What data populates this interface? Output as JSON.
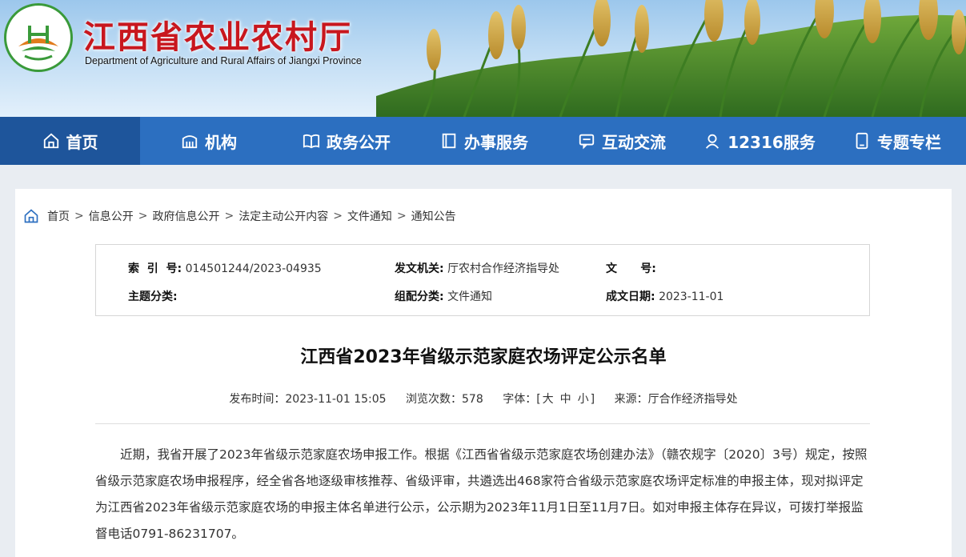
{
  "header": {
    "title": "江西省农业农村厅",
    "subtitle": "Department of Agriculture and Rural Affairs of Jiangxi Province"
  },
  "nav": [
    {
      "label": "首页",
      "icon": "home-icon",
      "active": true
    },
    {
      "label": "机构",
      "icon": "building-icon"
    },
    {
      "label": "政务公开",
      "icon": "book-icon"
    },
    {
      "label": "办事服务",
      "icon": "document-icon"
    },
    {
      "label": "互动交流",
      "icon": "chat-icon"
    },
    {
      "label": "12316服务",
      "icon": "service-icon"
    },
    {
      "label": "专题专栏",
      "icon": "tablet-icon"
    }
  ],
  "breadcrumb": [
    "首页",
    "信息公开",
    "政府信息公开",
    "法定主动公开内容",
    "文件通知",
    "通知公告"
  ],
  "info": {
    "index_label": "索  引  号:",
    "index_value": "014501244/2023-04935",
    "issuer_label": "发文机关:",
    "issuer_value": "厅农村合作经济指导处",
    "docno_label": "文      号:",
    "docno_value": "",
    "topic_label": "主题分类:",
    "topic_value": "",
    "genre_label": "组配分类:",
    "genre_value": "文件通知",
    "date_label": "成文日期:",
    "date_value": "2023-11-01"
  },
  "doc": {
    "title": "江西省2023年省级示范家庭农场评定公示名单",
    "publish_time": "发布时间：2023-11-01 15:05",
    "views": "浏览次数：578",
    "font_label": "字体：[",
    "font_big": "大",
    "font_mid": "中",
    "font_small": "小",
    "font_close": "]",
    "source": "来源：厅合作经济指导处",
    "body": "近期，我省开展了2023年省级示范家庭农场申报工作。根据《江西省省级示范家庭农场创建办法》（赣农规字〔2020〕3号）规定，按照省级示范家庭农场申报程序，经全省各地逐级审核推荐、省级评审，共遴选出468家符合省级示范家庭农场评定标准的申报主体，现对拟评定为江西省2023年省级示范家庭农场的申报主体名单进行公示，公示期为2023年11月1日至11月7日。如对申报主体存在异议，可拨打举报监督电话0791-86231707。"
  },
  "colors": {
    "nav": "#2c6fc0",
    "nav_active": "#1e559b",
    "title_red": "#c8171e"
  }
}
